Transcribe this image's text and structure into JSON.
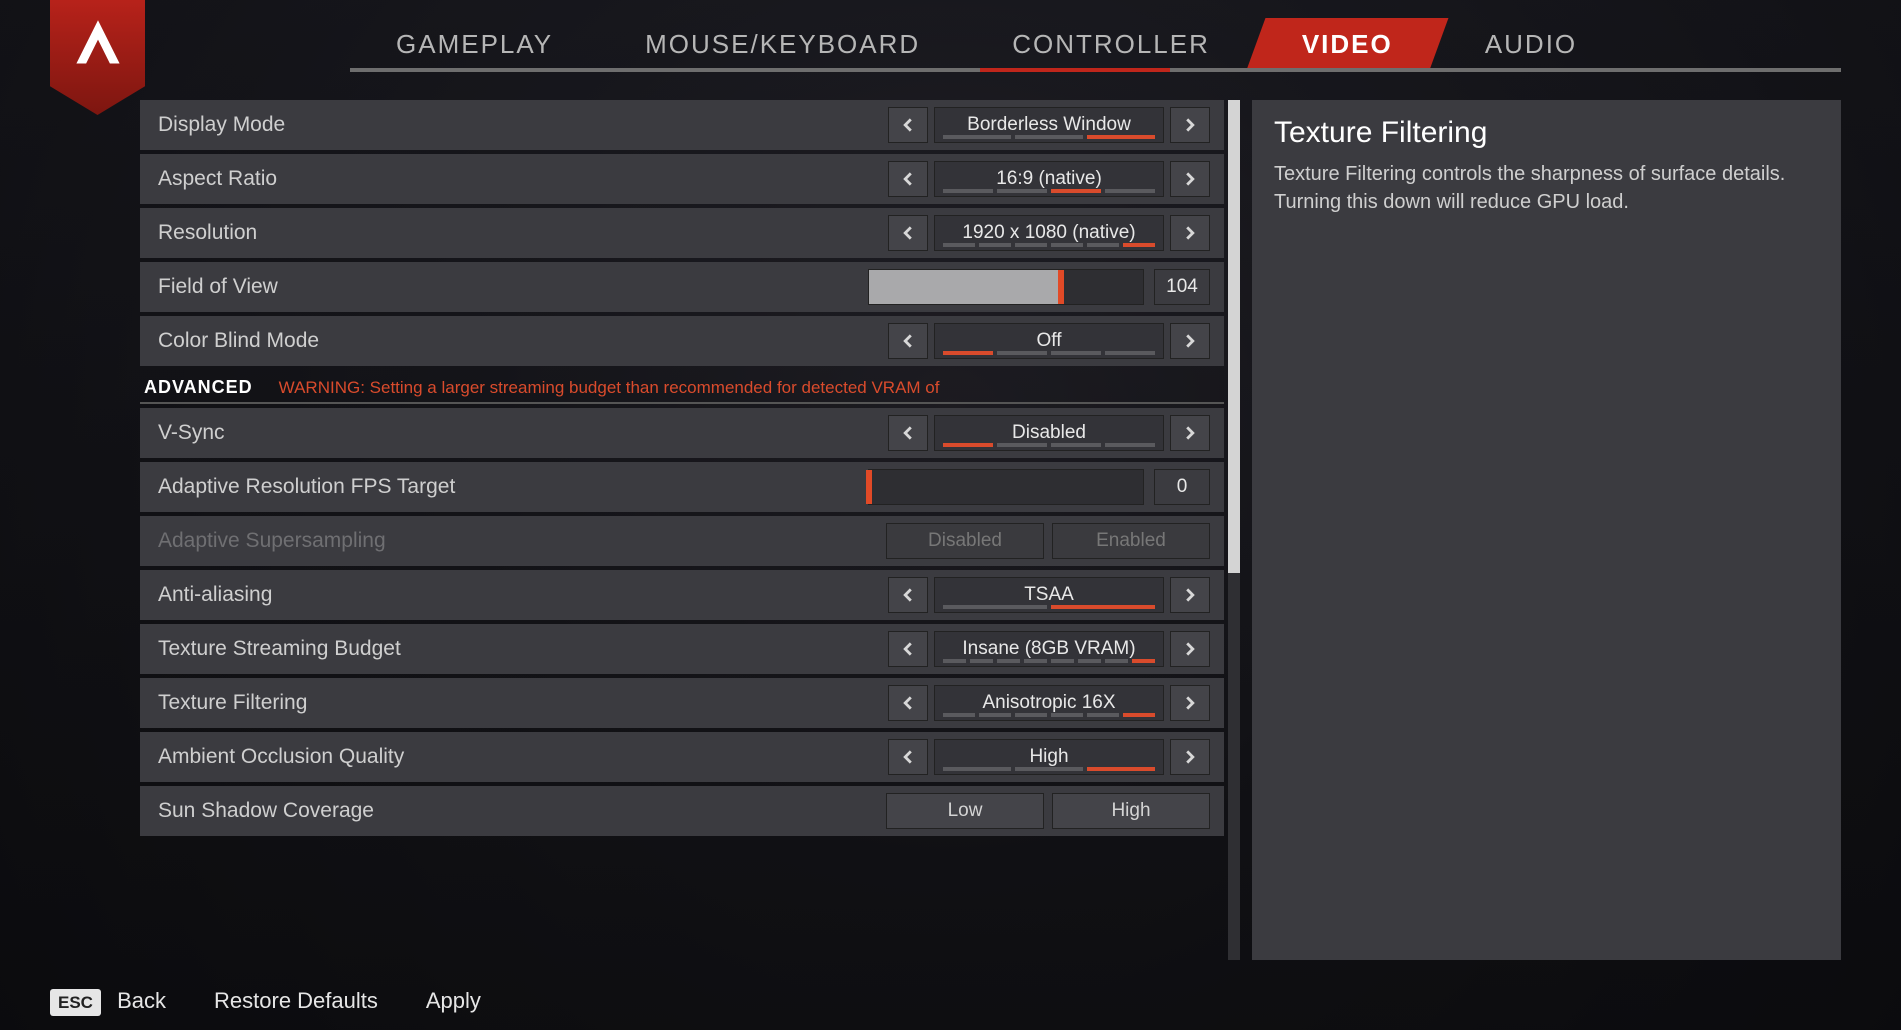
{
  "tabs": [
    "GAMEPLAY",
    "MOUSE/KEYBOARD",
    "CONTROLLER",
    "VIDEO",
    "AUDIO"
  ],
  "active_tab": "VIDEO",
  "sidebar": {
    "title": "Texture Filtering",
    "desc": "Texture Filtering controls the sharpness of surface details. Turning this down will reduce GPU load."
  },
  "section": {
    "advanced_label": "ADVANCED",
    "warning": "WARNING: Setting a larger streaming budget than recommended for detected VRAM of"
  },
  "rows": {
    "display_mode": {
      "label": "Display Mode",
      "value": "Borderless Window",
      "ticks": 3,
      "sel": 2
    },
    "aspect_ratio": {
      "label": "Aspect Ratio",
      "value": "16:9 (native)",
      "ticks": 4,
      "sel": 2
    },
    "resolution": {
      "label": "Resolution",
      "value": "1920 x 1080 (native)",
      "ticks": 6,
      "sel": 5
    },
    "fov": {
      "label": "Field of View",
      "value": "104",
      "fill": 0.7
    },
    "color_blind": {
      "label": "Color Blind Mode",
      "value": "Off",
      "ticks": 4,
      "sel": 0
    },
    "vsync": {
      "label": "V-Sync",
      "value": "Disabled",
      "ticks": 4,
      "sel": 0
    },
    "adaptive_fps": {
      "label": "Adaptive Resolution FPS Target",
      "value": "0",
      "fill": 0.0
    },
    "adaptive_ss": {
      "label": "Adaptive Supersampling",
      "options": [
        "Disabled",
        "Enabled"
      ]
    },
    "anti_aliasing": {
      "label": "Anti-aliasing",
      "value": "TSAA",
      "ticks": 2,
      "sel": 1
    },
    "tex_stream": {
      "label": "Texture Streaming Budget",
      "value": "Insane (8GB VRAM)",
      "ticks": 8,
      "sel": 7
    },
    "tex_filter": {
      "label": "Texture Filtering",
      "value": "Anisotropic 16X",
      "ticks": 6,
      "sel": 5
    },
    "ambient_occ": {
      "label": "Ambient Occlusion Quality",
      "value": "High",
      "ticks": 3,
      "sel": 2
    },
    "sun_shadow": {
      "label": "Sun Shadow Coverage",
      "options": [
        "Low",
        "High"
      ]
    }
  },
  "footer": {
    "esc_key": "ESC",
    "back": "Back",
    "restore": "Restore Defaults",
    "apply": "Apply"
  }
}
